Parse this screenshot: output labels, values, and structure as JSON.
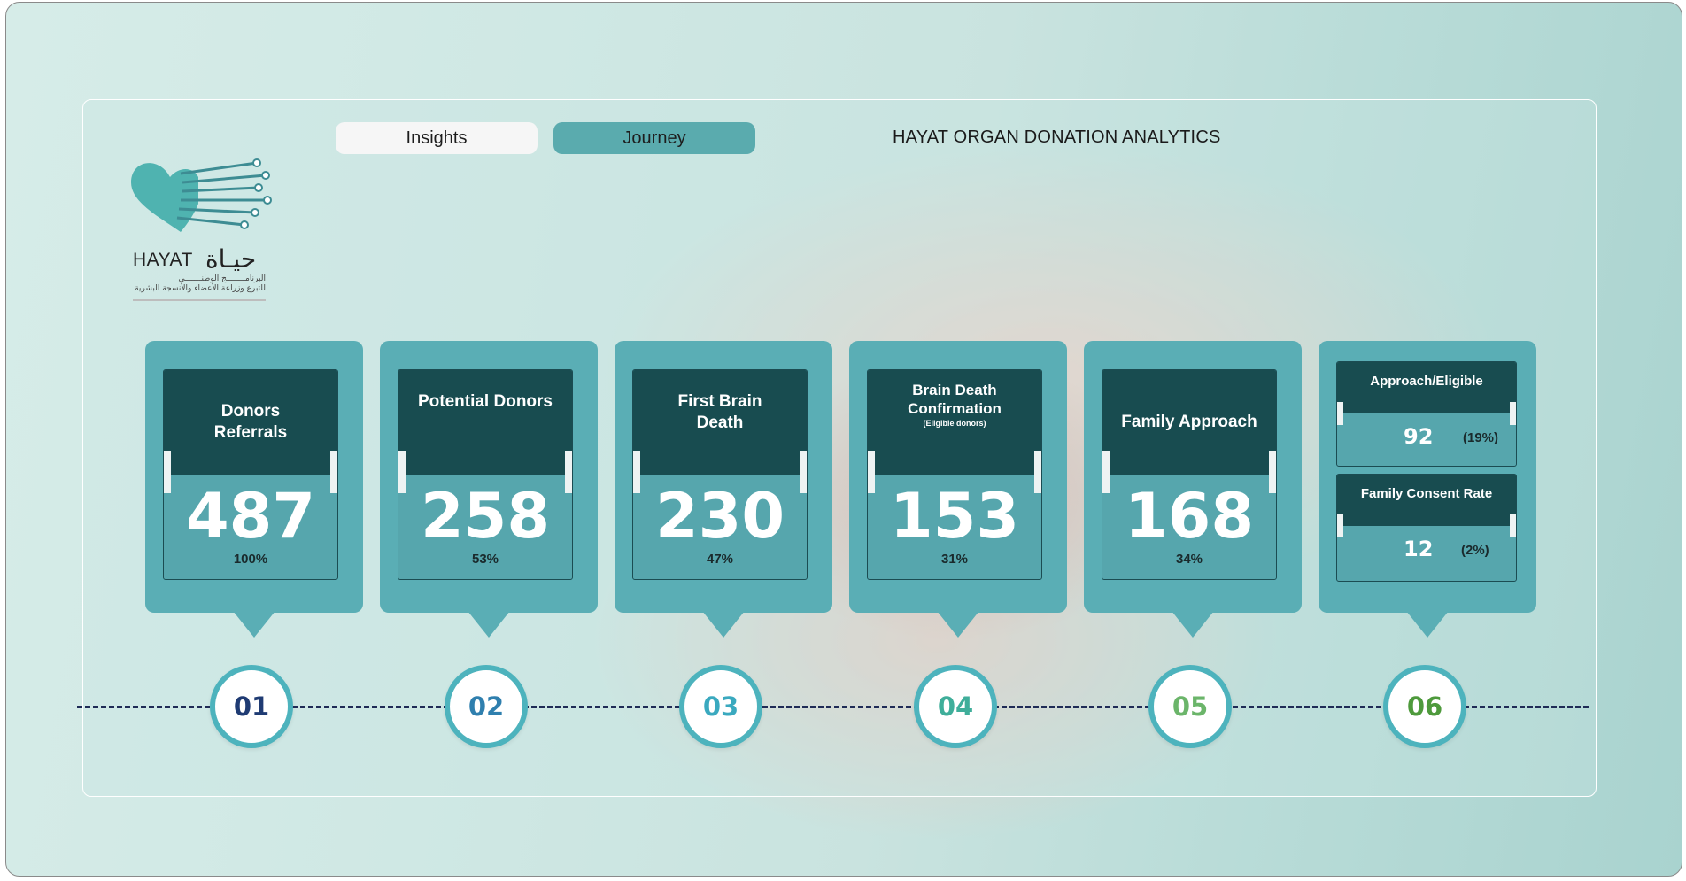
{
  "tabs": {
    "insights": "Insights",
    "journey": "Journey"
  },
  "header": {
    "title": "HAYAT ORGAN DONATION ANALYTICS"
  },
  "logo": {
    "name_en": "HAYAT",
    "name_ar": "حيـاة",
    "subtitle_ar_1": "البرنامــــــــج الوطنـــــــي",
    "subtitle_ar_2": "للتبرع وزراعة الأعضاء والأنسجة البشرية"
  },
  "cards": [
    {
      "title": "Donors Referrals",
      "value": "487",
      "percent": "100%"
    },
    {
      "title": "Potential Donors",
      "value": "258",
      "percent": "53%"
    },
    {
      "title": "First Brain Death",
      "value": "230",
      "percent": "47%"
    },
    {
      "title": "Brain Death Confirmation",
      "note": "(Eligible donors)",
      "value": "153",
      "percent": "31%"
    },
    {
      "title": "Family Approach",
      "value": "168",
      "percent": "34%"
    }
  ],
  "rates": [
    {
      "title": "Approach/Eligible",
      "value": "92",
      "percent": "(19%)"
    },
    {
      "title": "Family Consent Rate",
      "value": "12",
      "percent": "(2%)"
    }
  ],
  "steps": [
    {
      "label": "01",
      "color": "#1f3b73"
    },
    {
      "label": "02",
      "color": "#2f7fae"
    },
    {
      "label": "03",
      "color": "#3aa9bf"
    },
    {
      "label": "04",
      "color": "#3fae9a"
    },
    {
      "label": "05",
      "color": "#6bb56a"
    },
    {
      "label": "06",
      "color": "#4e9a3c"
    }
  ],
  "colors": {
    "card": "#5aaeb5",
    "card_header": "#184c50",
    "tab_active": "#5aabae",
    "timeline": "#1f2b56"
  }
}
